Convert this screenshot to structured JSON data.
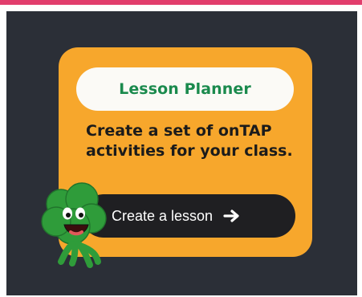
{
  "card": {
    "title": "Lesson Planner",
    "description": "Create a set of onTAP activities for your class.",
    "cta_label": "Create a lesson"
  },
  "icons": {
    "cta_icon": "arrow-right-icon",
    "mascot": "clover-mascot"
  },
  "colors": {
    "top_accent": "#e23e6d",
    "panel_bg": "#2b2f37",
    "card_bg": "#f7a72c",
    "title_text": "#1a8a4d",
    "button_bg": "#1f1f22",
    "mascot": "#2f9c3a"
  }
}
